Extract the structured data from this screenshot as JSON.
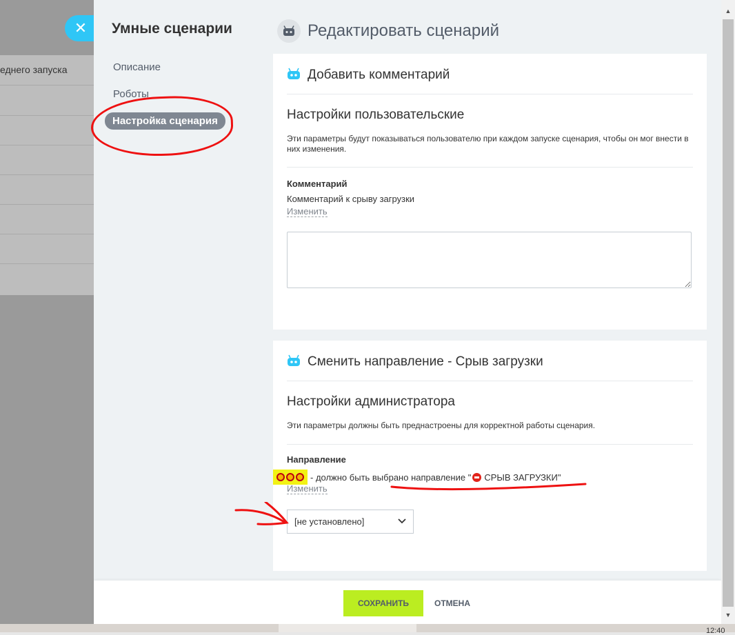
{
  "background": {
    "row_text": "еднего запуска",
    "close_symbol": "✕"
  },
  "nav": {
    "title": "Умные сценарии",
    "items": [
      {
        "label": "Описание"
      },
      {
        "label": "Роботы"
      },
      {
        "label": "Настройка сценария",
        "active": true
      }
    ]
  },
  "page": {
    "title": "Редактировать сценарий"
  },
  "comment_card": {
    "header": "Добавить комментарий",
    "section_title": "Настройки пользовательские",
    "section_desc": "Эти параметры будут показываться пользователю при каждом запуске сценария, чтобы он мог внести в них изменения.",
    "field_label": "Комментарий",
    "field_value": "Комментарий к срыву загрузки",
    "change_link": "Изменить",
    "textarea_value": ""
  },
  "direction_card": {
    "header": "Сменить направление - Срыв загрузки",
    "section_title": "Настройки администратора",
    "section_desc": "Эти параметры должны быть преднастроены для корректной работы сценария.",
    "field_label": "Направление",
    "field_value_prefix": "- должно быть выбрано направление \"",
    "field_value_target": "СРЫВ ЗАГРУЗКИ",
    "field_value_suffix": "\"",
    "change_link": "Изменить",
    "select_value": "[не установлено]"
  },
  "footer": {
    "save_label": "СОХРАНИТЬ",
    "cancel_label": "ОТМЕНА"
  },
  "taskbar": {
    "clock": "12:40"
  },
  "colors": {
    "accent_blue": "#2fc6f6",
    "save_green": "#bbed21",
    "active_nav": "#7f8792",
    "annotation_red": "#e11111",
    "highlight_yellow": "#f2f214"
  }
}
